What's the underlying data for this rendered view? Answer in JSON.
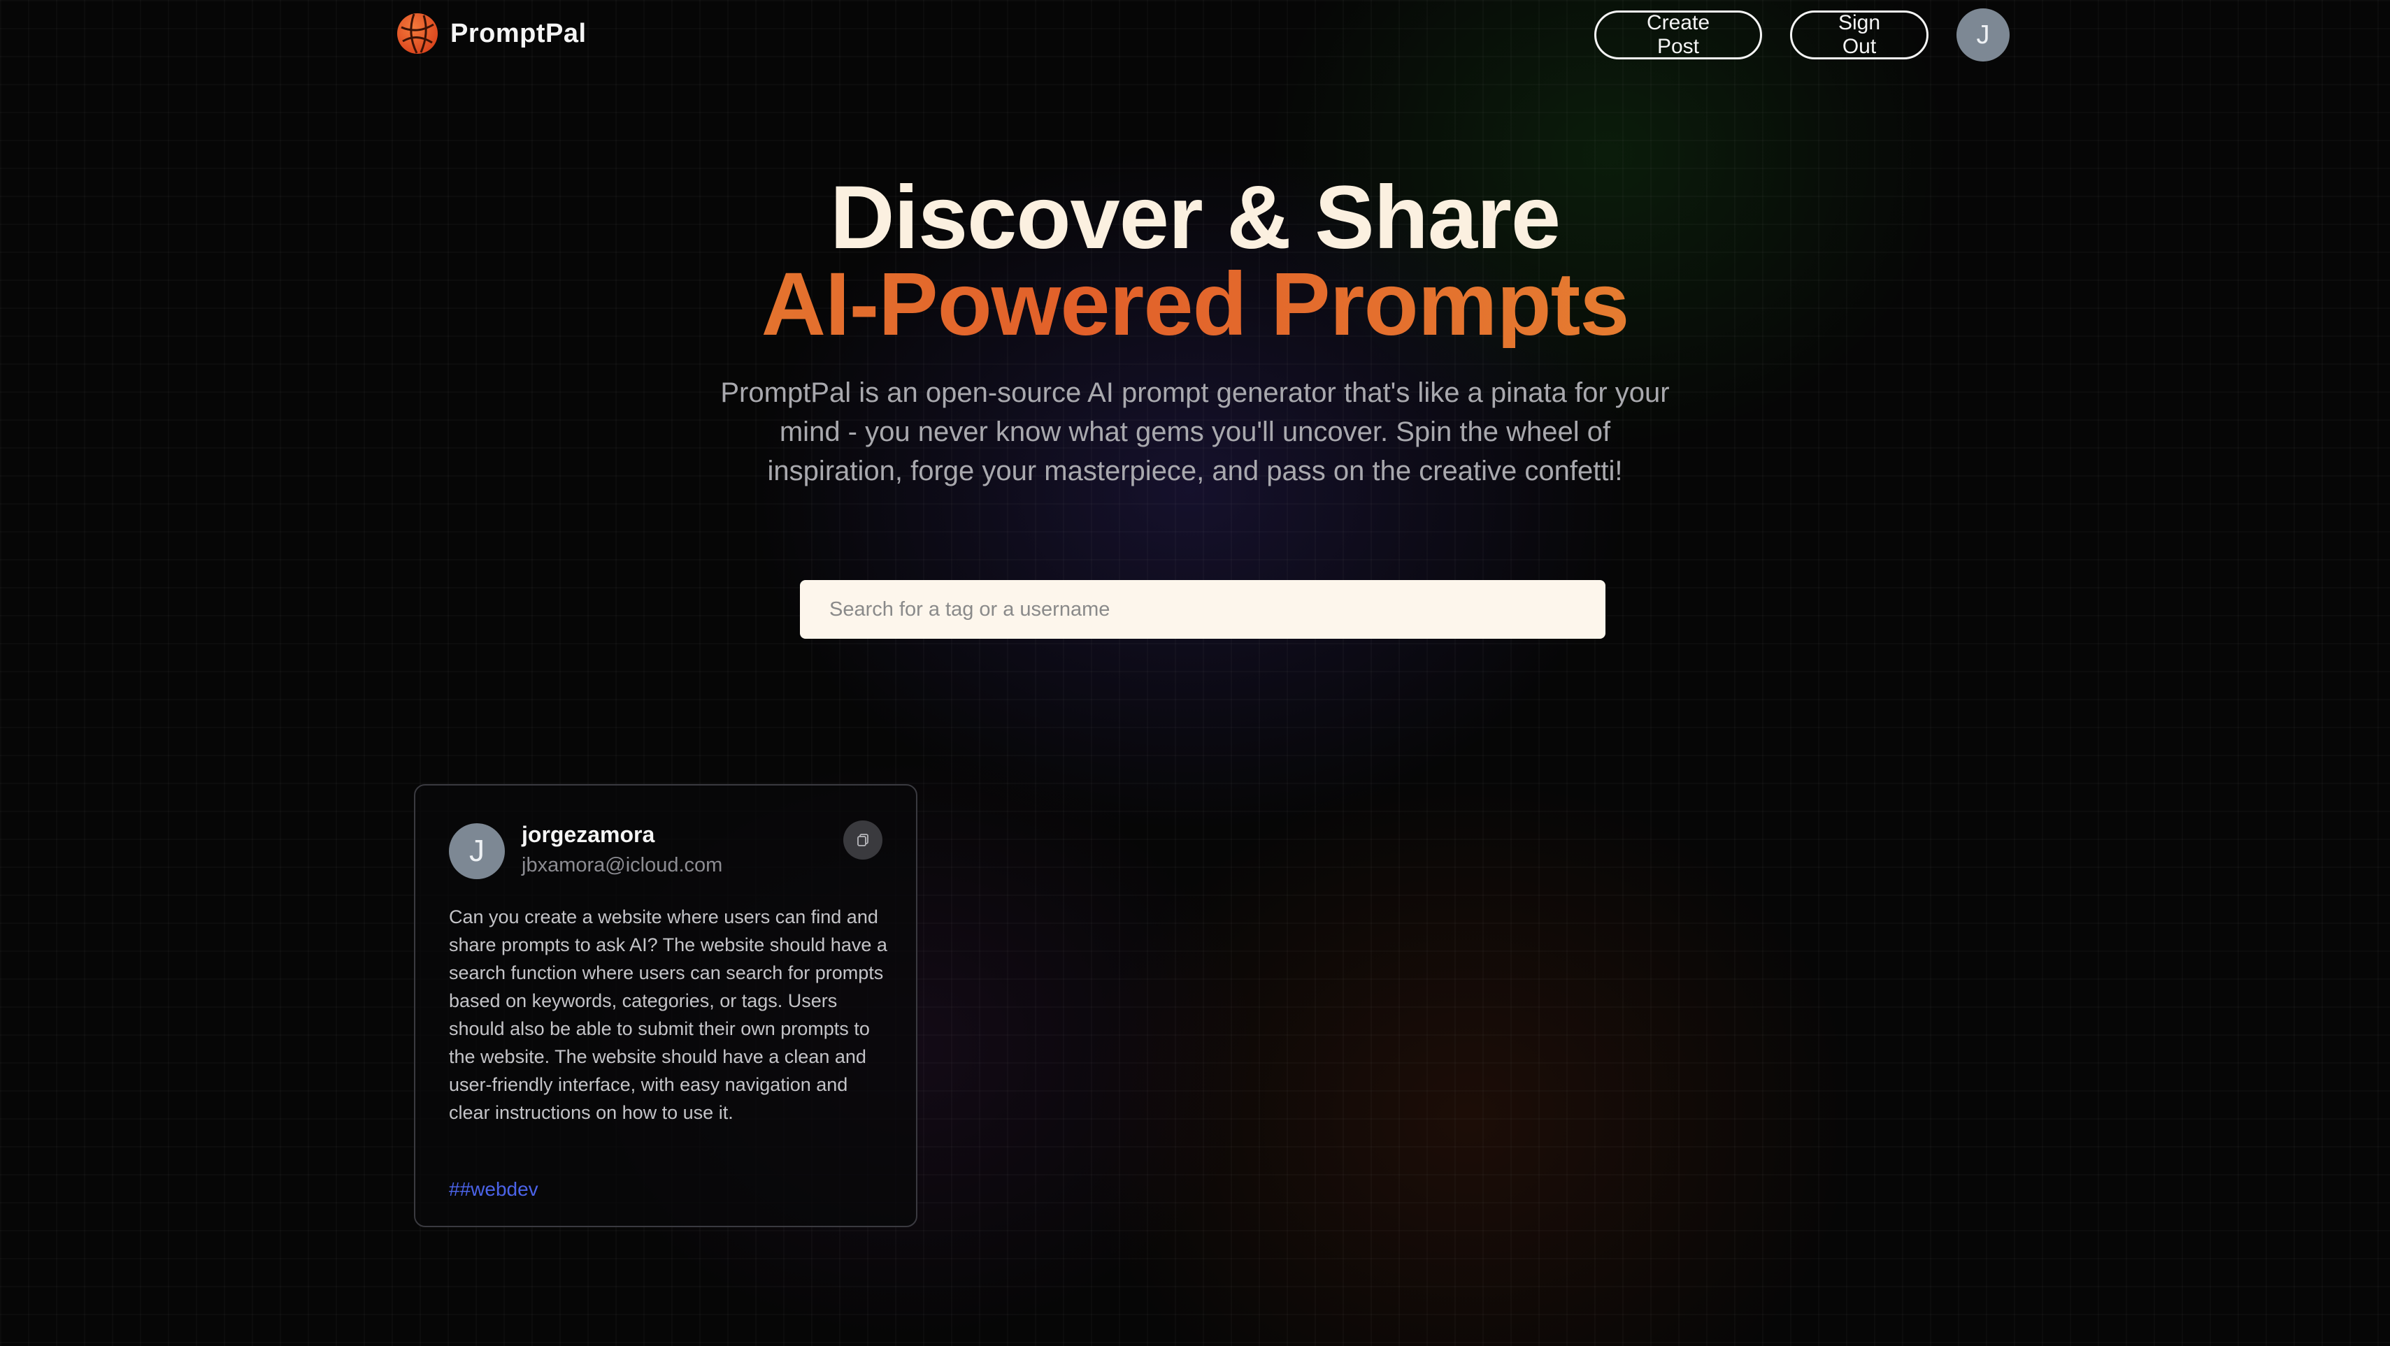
{
  "nav": {
    "brand_name": "PromptPal",
    "create_post_label": "Create Post",
    "sign_out_label": "Sign Out",
    "avatar_initial": "J"
  },
  "hero": {
    "title_line_1": "Discover & Share",
    "title_line_2": "AI-Powered Prompts",
    "description": "PromptPal is an open-source AI prompt generator that's like a pinata for your mind - you never know what gems you'll uncover. Spin the wheel of inspiration, forge your masterpiece, and pass on the creative confetti!"
  },
  "search": {
    "placeholder": "Search for a tag or a username",
    "value": ""
  },
  "posts": [
    {
      "avatar_initial": "J",
      "username": "jorgezamora",
      "email": "jbxamora@icloud.com",
      "prompt": "Can you create a website where users can find and share prompts to ask AI? The website should have a search function where users can search for prompts based on keywords, categories, or tags. Users should also be able to submit their own prompts to the website. The website should have a clean and user-friendly interface, with easy navigation and clear instructions on how to use it.",
      "tag": "##webdev"
    }
  ],
  "colors": {
    "background": "#060606",
    "title_cream": "#fbf0e0",
    "title_gradient_start": "#e9a23a",
    "title_gradient_mid": "#e2602a",
    "tag_blue": "#4b63e8",
    "avatar_gray": "#7d8894",
    "search_bg": "#fdf6ec"
  },
  "icons": {
    "brand": "globe-logo-icon",
    "copy": "copy-icon"
  }
}
